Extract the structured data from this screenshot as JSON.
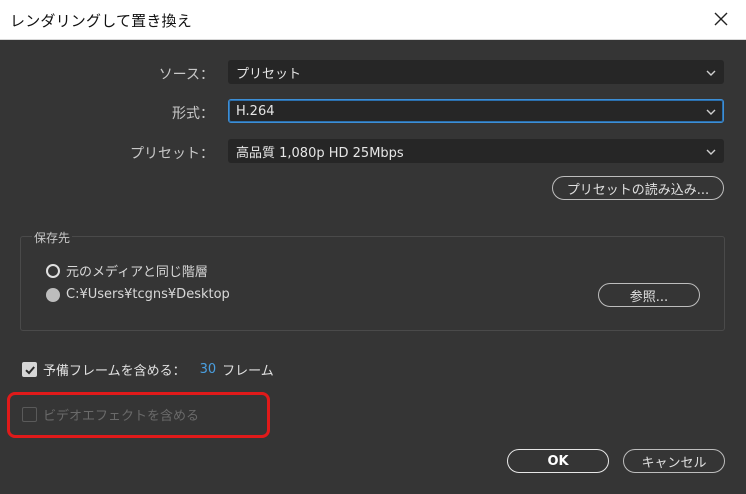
{
  "window": {
    "title": "レンダリングして置き換え"
  },
  "form": {
    "source": {
      "label": "ソース：",
      "value": "プリセット"
    },
    "format": {
      "label": "形式：",
      "value": "H.264"
    },
    "preset": {
      "label": "プリセット：",
      "value": "高品質 1,080p HD 25Mbps"
    },
    "load_preset_label": "プリセットの読み込み..."
  },
  "destination": {
    "group_label": "保存先",
    "option_same_label": "元のメディアと同じ階層",
    "option_path_label": "C:¥Users¥tcgns¥Desktop",
    "browse_label": "参照..."
  },
  "handles": {
    "label": "予備フレームを含める：",
    "count": "30",
    "unit": "フレーム",
    "checked": true
  },
  "effects": {
    "label": "ビデオエフェクトを含める",
    "checked": false,
    "enabled": false
  },
  "footer": {
    "ok_label": "OK",
    "cancel_label": "キャンセル"
  },
  "colors": {
    "background": "#353535",
    "field": "#262626",
    "focus": "#3d8fd6",
    "accent_number": "#4a9fe0",
    "highlight": "#e01a1a"
  }
}
